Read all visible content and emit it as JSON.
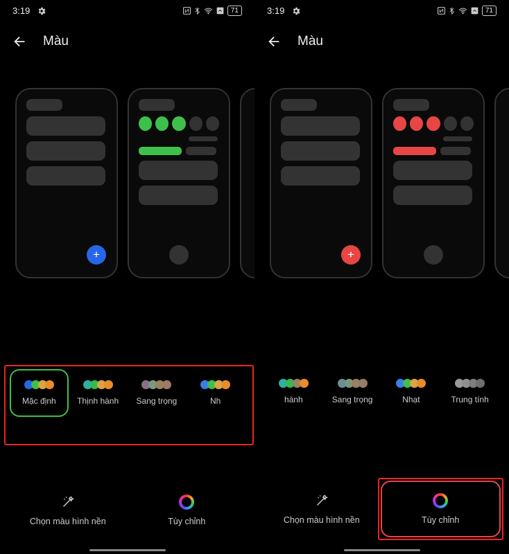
{
  "statusBar": {
    "time": "3:19",
    "battery": "71"
  },
  "header": {
    "title": "Màu"
  },
  "accentColors": {
    "blue": "#2766e8",
    "red": "#e84545",
    "green": "#3dc04b"
  },
  "leftScreen": {
    "palettes": [
      {
        "label": "Mặc định",
        "colors": [
          "#2766e8",
          "#3dc04b",
          "#d9a542",
          "#e88c2d"
        ],
        "selected": true
      },
      {
        "label": "Thịnh hành",
        "colors": [
          "#2eb0a0",
          "#36b84e",
          "#d9a542",
          "#e88c2d"
        ],
        "selected": false
      },
      {
        "label": "Sang trọng",
        "colors": [
          "#8a6f8a",
          "#7d977d",
          "#998060",
          "#9a7a68"
        ],
        "selected": false
      },
      {
        "label": "Nh",
        "colors": [
          "#3a7ee6",
          "#3dc04b",
          "#d9a542",
          "#e88c2d"
        ],
        "selected": false
      }
    ],
    "bottom": {
      "wallpaperColor": "Chọn màu hình nền",
      "customize": "Tùy chỉnh"
    }
  },
  "rightScreen": {
    "palettes": [
      {
        "label": "hành",
        "colors": [
          "#2eb0a0",
          "#36b84e",
          "#998060",
          "#e88c2d"
        ],
        "selected": false
      },
      {
        "label": "Sang trọng",
        "colors": [
          "#6f8c9a",
          "#7d977d",
          "#998060",
          "#9a7a68"
        ],
        "selected": false
      },
      {
        "label": "Nhạt",
        "colors": [
          "#3a7ee6",
          "#3dc04b",
          "#d9a542",
          "#e88c2d"
        ],
        "selected": false
      },
      {
        "label": "Trung tính",
        "colors": [
          "#9a9a9a",
          "#8f8f8f",
          "#7e7e7e",
          "#6e6e6e"
        ],
        "selected": false
      }
    ],
    "bottom": {
      "wallpaperColor": "Chọn màu hình nền",
      "customize": "Tùy chỉnh"
    }
  }
}
